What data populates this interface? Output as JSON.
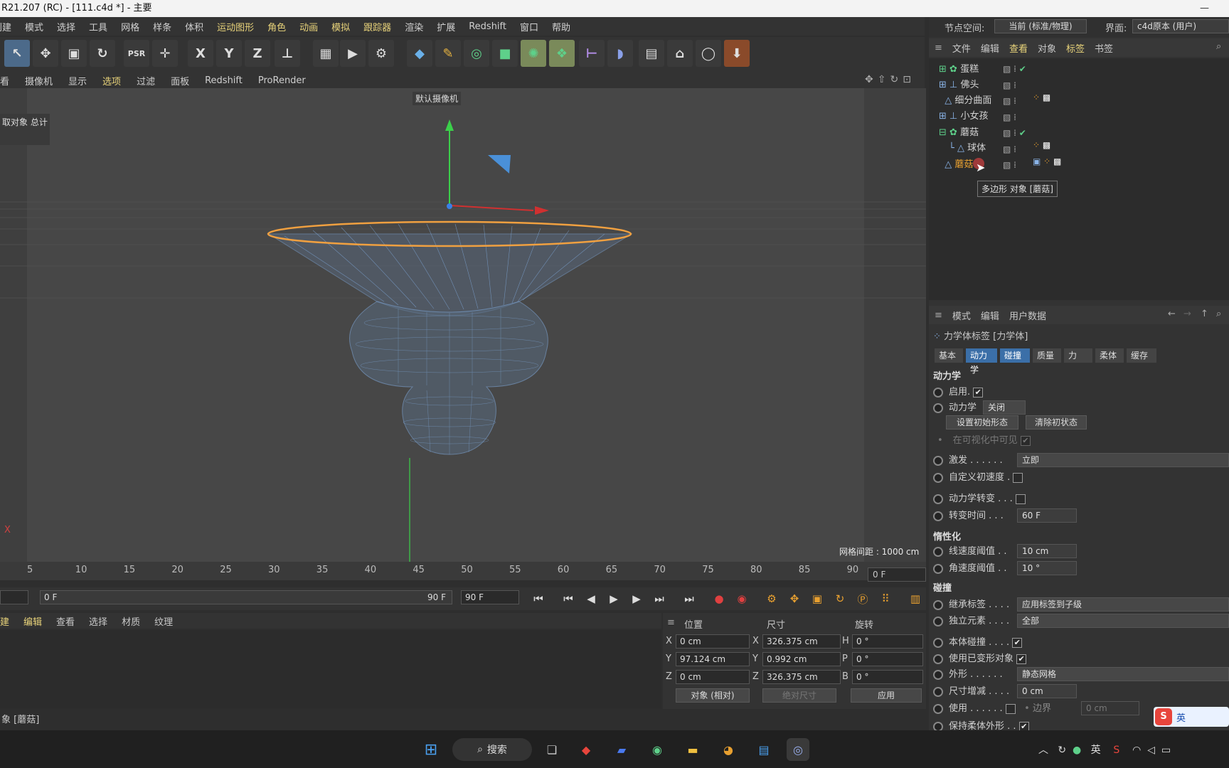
{
  "title": "R21.207 (RC) - [111.c4d *] - 主要",
  "menu": [
    "创建",
    "模式",
    "选择",
    "工具",
    "网格",
    "样条",
    "体积",
    "运动图形",
    "角色",
    "动画",
    "模拟",
    "跟踪器",
    "渲染",
    "扩展",
    "Redshift",
    "窗口",
    "帮助"
  ],
  "toolbar_letters": [
    "X",
    "Y",
    "Z"
  ],
  "viewport_menu": [
    "看",
    "摄像机",
    "显示",
    "选项",
    "过滤",
    "面板",
    "Redshift",
    "ProRender"
  ],
  "viewport": {
    "camera_label": "默认摄像机",
    "hud_title": "取对象 总计",
    "grid_spacing": "网格间距 : 1000 cm",
    "axis_label": "X"
  },
  "timeline": {
    "ticks": [
      "5",
      "10",
      "15",
      "20",
      "25",
      "30",
      "35",
      "40",
      "45",
      "50",
      "55",
      "60",
      "65",
      "70",
      "75",
      "80",
      "85",
      "90"
    ],
    "current": "0 F"
  },
  "playback": {
    "start": "0 F",
    "range_end": "90 F",
    "end": "90 F"
  },
  "material_tabs": [
    "建",
    "编辑",
    "查看",
    "选择",
    "材质",
    "纹理"
  ],
  "coords": {
    "headers": [
      "位置",
      "尺寸",
      "旋转"
    ],
    "pos": {
      "x": "0 cm",
      "y": "97.124 cm",
      "z": "0 cm"
    },
    "size": {
      "x": "326.375 cm",
      "y": "0.992 cm",
      "z": "326.375 cm"
    },
    "rot": {
      "h": "0 °",
      "p": "0 °",
      "b": "0 °"
    },
    "axis": [
      "X",
      "Y",
      "Z"
    ],
    "rot_axis": [
      "H",
      "P",
      "B"
    ],
    "mode": "对象 (相对)",
    "size_mode": "绝对尺寸",
    "apply": "应用"
  },
  "status": "象 [蘑菇]",
  "right": {
    "node_space_label": "节点空间:",
    "node_space_value": "当前 (标准/物理)",
    "interface_label": "界面:",
    "interface_value": "c4d原本 (用户)",
    "obj_menu": [
      "文件",
      "编辑",
      "查看",
      "对象",
      "标签",
      "书签"
    ],
    "objects": [
      "蛋糕",
      "佛头",
      "细分曲面",
      "小女孩",
      "蘑菇",
      "球体",
      "蘑菇"
    ],
    "tooltip": "多边形 对象 [蘑菇]",
    "attr_menu": [
      "模式",
      "编辑",
      "用户数据"
    ],
    "tag_title": "力学体标签 [力学体]",
    "tabs": [
      "基本",
      "动力学",
      "碰撞",
      "质量",
      "力",
      "柔体",
      "缓存"
    ],
    "dyn": {
      "section": "动力学",
      "enable": "启用",
      "dynamics": "动力学",
      "dynamics_val": "关闭",
      "set_init": "设置初始形态",
      "clear_init": "清除初状态",
      "visible": "在可视化中可见",
      "trigger": "激发",
      "trigger_val": "立即",
      "custom_vel": "自定义初速度",
      "transition": "动力学转变",
      "trans_time": "转变时间",
      "trans_time_val": "60 F"
    },
    "inertia": {
      "section": "惰性化",
      "lin": "线速度阈值",
      "lin_val": "10 cm",
      "ang": "角速度阈值",
      "ang_val": "10 °"
    },
    "coll": {
      "section": "碰撞",
      "inherit": "继承标签",
      "inherit_val": "应用标签到子级",
      "indep": "独立元素",
      "indep_val": "全部",
      "self": "本体碰撞",
      "deformed": "使用已变形对象",
      "shape": "外形",
      "shape_val": "静态网格",
      "size_inc": "尺寸增减",
      "size_inc_val": "0 cm",
      "use": "使用",
      "border": "边界",
      "border_val": "0 cm",
      "keep_soft": "保持柔体外形"
    }
  },
  "taskbar": {
    "search": "搜索",
    "lang": "英",
    "ime": "英"
  }
}
